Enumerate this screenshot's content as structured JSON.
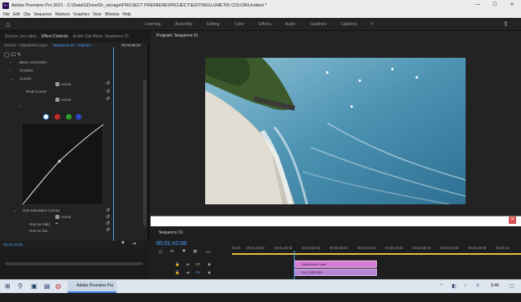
{
  "window": {
    "title": "Adobe Premiere Pro 2021 - C:\\Data\\GDrive\\Dr_storage\\PROJECT PREMIERE\\PROJECT\\EDITING\\LUMETRI COLOR\\Untitled *",
    "minimize": "—",
    "maximize": "☐",
    "close": "✕"
  },
  "menu": [
    "File",
    "Edit",
    "Clip",
    "Sequence",
    "Markers",
    "Graphics",
    "View",
    "Window",
    "Help"
  ],
  "workspaces": [
    "Learning",
    "Assembly",
    "Editing",
    "Color",
    "Effects",
    "Audio",
    "Graphics",
    "Captions"
  ],
  "left_panel": {
    "tabs": [
      "Source: (no clips)",
      "Effect Controls",
      "Audio Clip Mixer: Sequence 01"
    ],
    "source_label": "Source * Adjustment Layer",
    "sequence_label": "Sequence 01 * Adjustm...",
    "timecode_top": "00;02;08;04",
    "items": {
      "basic_correction": "Basic Correction",
      "creative": "Creative",
      "curves": "Curves",
      "active1": "Active",
      "rgb_curves": "RGB Curves",
      "active2": "Active",
      "hue_saturation": "Hue Saturation Curves",
      "active3": "Active",
      "hue_vs_sat": "Hue (vs Sat)",
      "hue_vs_sat2": "Hue vs Sat"
    },
    "timecode_bottom": "00;01;42;08"
  },
  "program": {
    "title": "Program: Sequence 01"
  },
  "timeline": {
    "title": "Sequence 01",
    "timecode": "00;01;42;08",
    "ruler": [
      "04;02",
      "00;01;20;02",
      "00;01;36;02",
      "00;01;52;02",
      "00;02;08;04",
      "00;02;24;04",
      "00;02;40;04",
      "00;02;56;04",
      "00;03;12;06",
      "00;03;28;06",
      "00;03;44"
    ],
    "tracks": {
      "v2": "V2",
      "v1": "V1"
    },
    "clips": {
      "adjustment": "Adjustment Layer",
      "video": "DJI_0055.MP4"
    }
  },
  "taskbar": {
    "active_app": "Adobe Premiere Pro 2...",
    "clock": "9:48"
  }
}
